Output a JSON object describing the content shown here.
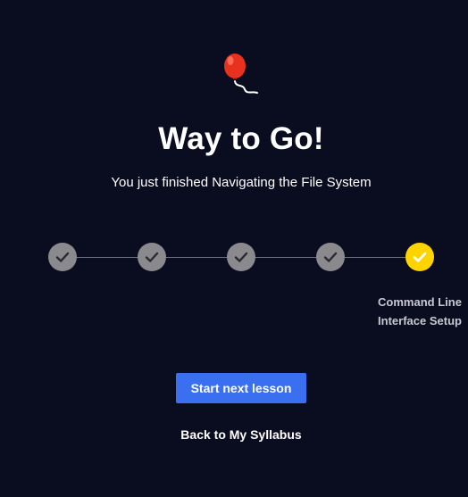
{
  "celebration": {
    "icon": "balloon-icon",
    "title": "Way to Go!",
    "subtitle": "You just finished Navigating the File System"
  },
  "progress": {
    "steps": [
      {
        "status": "completed",
        "icon": "checkmark-icon"
      },
      {
        "status": "completed",
        "icon": "checkmark-icon"
      },
      {
        "status": "completed",
        "icon": "checkmark-icon"
      },
      {
        "status": "completed",
        "icon": "checkmark-icon"
      },
      {
        "status": "current",
        "icon": "checkmark-icon",
        "label": "Command Line Interface Setup"
      }
    ],
    "completed_color": "#8a8a8e",
    "current_color": "#ffd400"
  },
  "actions": {
    "primary_label": "Start next lesson",
    "primary_color": "#3a6ff0",
    "secondary_label": "Back to My Syllabus"
  },
  "theme": {
    "background": "#0a0d1f"
  }
}
